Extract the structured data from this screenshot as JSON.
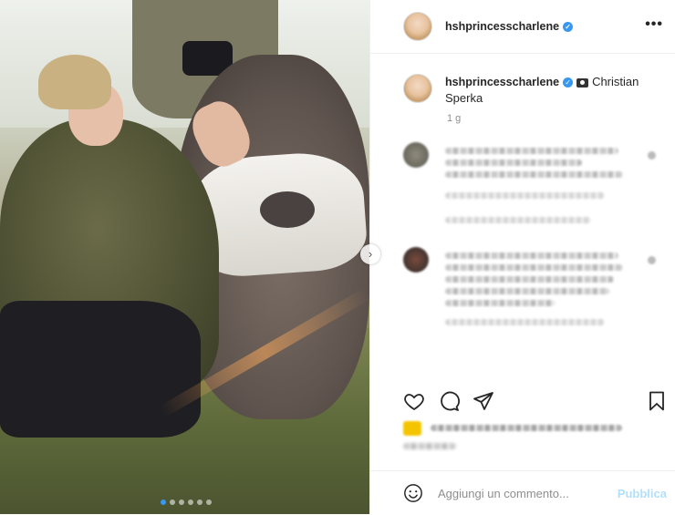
{
  "post": {
    "username": "hshprincesscharlene",
    "verified_icon": "verified-badge-icon",
    "caption_credit": "Christian Sperka",
    "time_ago": "1 g",
    "photo_icon": "camera-emoji-icon"
  },
  "header": {
    "more_label": "•••"
  },
  "carousel": {
    "next_label": "›",
    "count": 6,
    "active_index": 0
  },
  "actions": {
    "like_icon": "heart-icon",
    "comment_icon": "comment-icon",
    "share_icon": "paper-plane-icon",
    "save_icon": "bookmark-icon"
  },
  "comment_box": {
    "placeholder": "Aggiungi un commento...",
    "publish_label": "Pubblica",
    "emoji_icon": "smiley-icon"
  },
  "colors": {
    "accent": "#3897f0",
    "publish_disabled": "#b2dffc",
    "text": "#262626",
    "muted": "#8e8e8e"
  }
}
